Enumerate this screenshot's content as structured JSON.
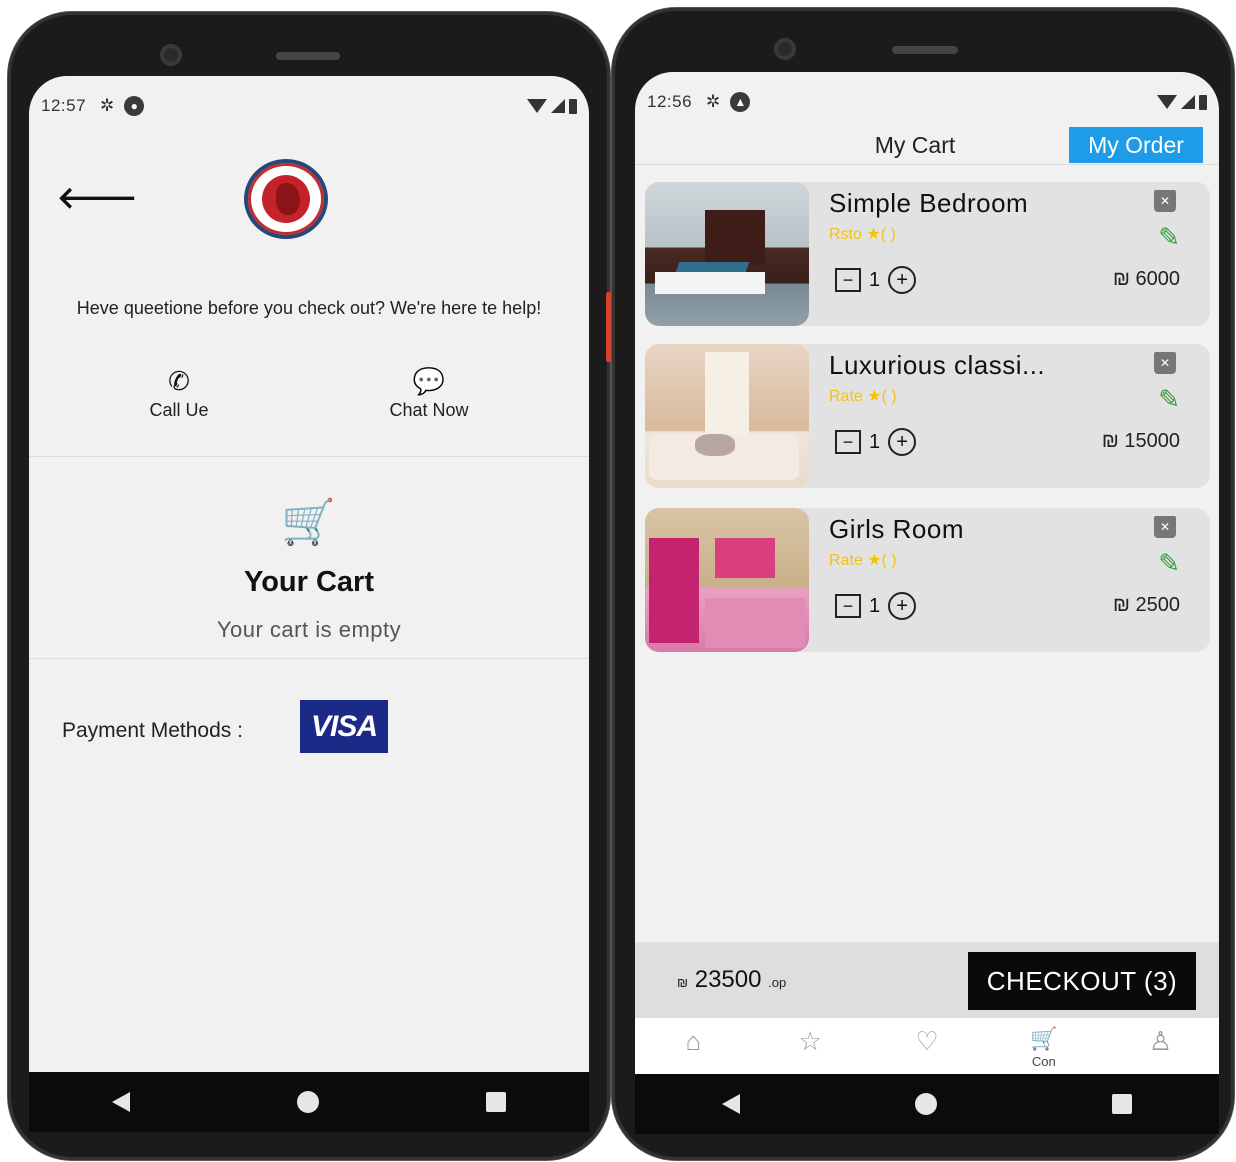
{
  "left_phone": {
    "status": {
      "time": "12:57"
    },
    "help_text": "Heve queetione before you check out? We're here te help!",
    "contacts": [
      {
        "label": "Call Ue",
        "icon": "phone-icon"
      },
      {
        "label": "Chat Now",
        "icon": "chat-icon"
      }
    ],
    "cart": {
      "title": "Your Cart",
      "empty_message": "Your cart is empty",
      "icon": "cart-icon"
    },
    "payment": {
      "label": "Payment Methods :",
      "card": "VISA"
    }
  },
  "right_phone": {
    "status": {
      "time": "12:56"
    },
    "header": {
      "title": "My Cart",
      "my_order_label": "My Order"
    },
    "items": [
      {
        "name": "Simple Bedroom",
        "rate_label": "Rsto",
        "rate_suffix": "( )",
        "quantity": "1",
        "price": "₪ 6000"
      },
      {
        "name": "Luxurious classi...",
        "rate_label": "Rate",
        "rate_suffix": "( )",
        "quantity": "1",
        "price": "₪ 15000"
      },
      {
        "name": "Girls Room",
        "rate_label": "Rate",
        "rate_suffix": "( )",
        "quantity": "1",
        "price": "₪ 2500"
      }
    ],
    "total": {
      "currency": "₪",
      "amount": "23500",
      "suffix": ".op"
    },
    "checkout_label": "CHECKOUT (3)",
    "tabs": [
      {
        "icon": "home-icon",
        "label": ""
      },
      {
        "icon": "star-icon",
        "label": ""
      },
      {
        "icon": "heart-icon",
        "label": ""
      },
      {
        "icon": "cart-icon",
        "label": "Con"
      },
      {
        "icon": "user-icon",
        "label": ""
      }
    ]
  },
  "colors": {
    "accent_blue": "#1f9ce8",
    "rate_yellow": "#f2c21a",
    "edit_green": "#2f9d3b",
    "visa_blue": "#1a2a86"
  }
}
